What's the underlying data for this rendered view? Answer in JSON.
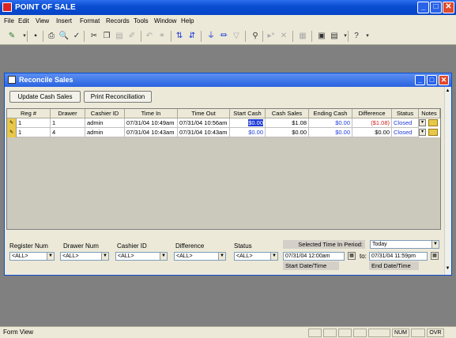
{
  "app": {
    "title": "POINT OF SALE",
    "colors": {
      "titlebar": "#0a4ed1",
      "face": "#ece9d8",
      "workspace": "#808080",
      "link": "#1f3bd8",
      "negative": "#d02020"
    }
  },
  "menu": [
    "File",
    "Edit",
    "View",
    "Insert",
    "Format",
    "Records",
    "Tools",
    "Window",
    "Help"
  ],
  "toolbar": {
    "icons": [
      "design-view-icon",
      "save-icon",
      "print-icon",
      "print-preview-icon",
      "spelling-icon",
      "cut-icon",
      "copy-icon",
      "paste-icon",
      "format-painter-icon",
      "undo-icon",
      "hyperlink-icon",
      "sort-ascending-icon",
      "sort-descending-icon",
      "filter-by-selection-icon",
      "filter-by-form-icon",
      "apply-filter-icon",
      "find-icon",
      "new-record-icon",
      "delete-record-icon",
      "properties-icon",
      "database-window-icon",
      "new-object-icon",
      "help-icon"
    ]
  },
  "form": {
    "title": "Reconcile Sales",
    "buttons": {
      "update": "Update Cash Sales",
      "print": "Print Reconciliation"
    },
    "columns": [
      "Reg #",
      "Drawer",
      "Cashier ID",
      "Time In",
      "Time Out",
      "Start Cash",
      "Cash Sales",
      "Ending Cash",
      "Difference",
      "Status",
      "Notes"
    ],
    "rows": [
      {
        "reg": "1",
        "drawer": "1",
        "cashier": "admin",
        "time_in": "07/31/04 10:49am",
        "time_out": "07/31/04 10:56am",
        "start_cash": "$0.00",
        "cash_sales": "$1.08",
        "ending_cash": "$0.00",
        "difference": "($1.08)",
        "status": "Closed"
      },
      {
        "reg": "1",
        "drawer": "4",
        "cashier": "admin",
        "time_in": "07/31/04 10:43am",
        "time_out": "07/31/04 10:43am",
        "start_cash": "$0.00",
        "cash_sales": "$0.00",
        "ending_cash": "$0.00",
        "difference": "$0.00",
        "status": "Closed"
      }
    ]
  },
  "filters": {
    "labels": {
      "register": "Register Num",
      "drawer": "Drawer Num",
      "cashier": "Cashier ID",
      "difference": "Difference",
      "status": "Status",
      "period": "Selected Time In Period:",
      "to": "to:",
      "start": "Start Date/Time",
      "end": "End Date/Time"
    },
    "values": {
      "register": "<ALL>",
      "drawer": "<ALL>",
      "cashier": "<ALL>",
      "difference": "<ALL>",
      "status": "<ALL>",
      "period": "Today",
      "start": "07/31/04 12:00am",
      "end": "07/31/04 11:59pm"
    }
  },
  "status": {
    "text": "Form View",
    "num": "NUM",
    "ovr": "OVR"
  }
}
